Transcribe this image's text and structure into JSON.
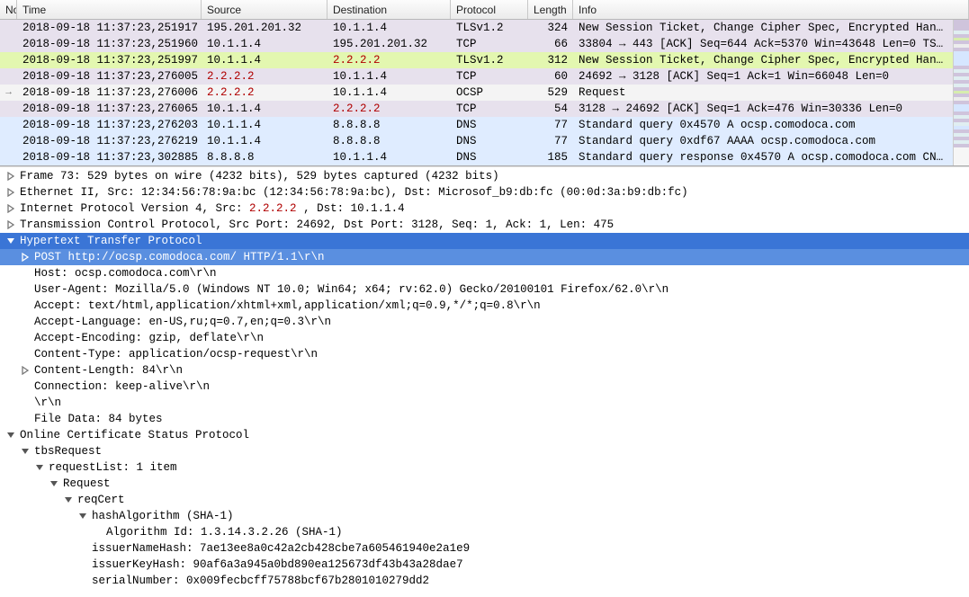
{
  "columns": {
    "no": "No.",
    "time": "Time",
    "source": "Source",
    "destination": "Destination",
    "protocol": "Protocol",
    "length": "Length",
    "info": "Info"
  },
  "packets": [
    {
      "marker": "",
      "cls": "row-purple",
      "time": "2018-09-18 11:37:23,251917",
      "src": "195.201.201.32",
      "dst": "10.1.1.4",
      "proto": "TLSv1.2",
      "len": "324",
      "info": "New Session Ticket, Change Cipher Spec, Encrypted Han…"
    },
    {
      "marker": "",
      "cls": "row-purple",
      "time": "2018-09-18 11:37:23,251960",
      "src": "10.1.1.4",
      "dst": "195.201.201.32",
      "proto": "TCP",
      "len": "66",
      "info": "33804 → 443 [ACK] Seq=644 Ack=5370 Win=43648 Len=0 TS…"
    },
    {
      "marker": "",
      "cls": "row-green",
      "time": "2018-09-18 11:37:23,251997",
      "src": "10.1.1.4",
      "dst": "2.2.2.2",
      "dred": true,
      "proto": "TLSv1.2",
      "len": "312",
      "info": "New Session Ticket, Change Cipher Spec, Encrypted Han…"
    },
    {
      "marker": "",
      "cls": "row-purple",
      "time": "2018-09-18 11:37:23,276005",
      "src": "2.2.2.2",
      "sred": true,
      "dst": "10.1.1.4",
      "proto": "TCP",
      "len": "60",
      "info": "24692 → 3128 [ACK] Seq=1 Ack=1 Win=66048 Len=0"
    },
    {
      "marker": "→",
      "cls": "row-grey",
      "time": "2018-09-18 11:37:23,276006",
      "src": "2.2.2.2",
      "sred": true,
      "dst": "10.1.1.4",
      "proto": "OCSP",
      "len": "529",
      "info": "Request"
    },
    {
      "marker": "",
      "cls": "row-purple",
      "time": "2018-09-18 11:37:23,276065",
      "src": "10.1.1.4",
      "dst": "2.2.2.2",
      "dred": true,
      "proto": "TCP",
      "len": "54",
      "info": "3128 → 24692 [ACK] Seq=1 Ack=476 Win=30336 Len=0"
    },
    {
      "marker": "",
      "cls": "row-blue",
      "time": "2018-09-18 11:37:23,276203",
      "src": "10.1.1.4",
      "dst": "8.8.8.8",
      "proto": "DNS",
      "len": "77",
      "info": "Standard query 0x4570 A ocsp.comodoca.com"
    },
    {
      "marker": "",
      "cls": "row-blue",
      "time": "2018-09-18 11:37:23,276219",
      "src": "10.1.1.4",
      "dst": "8.8.8.8",
      "proto": "DNS",
      "len": "77",
      "info": "Standard query 0xdf67 AAAA ocsp.comodoca.com"
    },
    {
      "marker": "",
      "cls": "row-blue",
      "time": "2018-09-18 11:37:23,302885",
      "src": "8.8.8.8",
      "dst": "10.1.1.4",
      "proto": "DNS",
      "len": "185",
      "info": "Standard query response 0x4570 A ocsp.comodoca.com CN…"
    }
  ],
  "detail": {
    "frame": "Frame 73: 529 bytes on wire (4232 bits), 529 bytes captured (4232 bits)",
    "eth": "Ethernet II, Src: 12:34:56:78:9a:bc (12:34:56:78:9a:bc), Dst: Microsof_b9:db:fc (00:0d:3a:b9:db:fc)",
    "ip_pre": "Internet Protocol Version 4, Src: ",
    "ip_src": "2.2.2.2",
    "ip_post": " , Dst: 10.1.1.4",
    "tcp": "Transmission Control Protocol, Src Port: 24692, Dst Port: 3128, Seq: 1, Ack: 1, Len: 475",
    "http_title": "Hypertext Transfer Protocol",
    "http_post": "POST http://ocsp.comodoca.com/ HTTP/1.1\\r\\n",
    "http_host": "Host: ocsp.comodoca.com\\r\\n",
    "http_ua": "User-Agent: Mozilla/5.0 (Windows NT 10.0; Win64; x64; rv:62.0) Gecko/20100101 Firefox/62.0\\r\\n",
    "http_accept": "Accept: text/html,application/xhtml+xml,application/xml;q=0.9,*/*;q=0.8\\r\\n",
    "http_lang": "Accept-Language: en-US,ru;q=0.7,en;q=0.3\\r\\n",
    "http_enc": "Accept-Encoding: gzip, deflate\\r\\n",
    "http_ct": "Content-Type: application/ocsp-request\\r\\n",
    "http_cl": "Content-Length: 84\\r\\n",
    "http_conn": "Connection: keep-alive\\r\\n",
    "http_crlf": "\\r\\n",
    "http_fd": "File Data: 84 bytes",
    "ocsp_title": "Online Certificate Status Protocol",
    "ocsp_tbs": "tbsRequest",
    "ocsp_reqlist": "requestList: 1 item",
    "ocsp_req": "Request",
    "ocsp_reqcert": "reqCert",
    "ocsp_hash": "hashAlgorithm (SHA-1)",
    "ocsp_algo": "Algorithm Id: 1.3.14.3.2.26 (SHA-1)",
    "ocsp_inh": "issuerNameHash: 7ae13ee8a0c42a2cb428cbe7a605461940e2a1e9",
    "ocsp_ikh": "issuerKeyHash: 90af6a3a945a0bd890ea125673df43b43a28dae7",
    "ocsp_sn": "serialNumber: 0x009fecbcff75788bcf67b2801010279dd2"
  }
}
